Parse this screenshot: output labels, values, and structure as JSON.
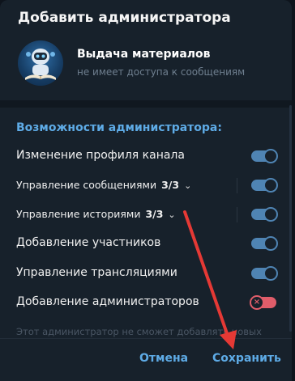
{
  "dialog": {
    "title": "Добавить администратора"
  },
  "profile": {
    "name": "Выдача материалов",
    "status": "не имеет доступа к сообщениям"
  },
  "permissions": {
    "title": "Возможности администратора:",
    "items": [
      {
        "label": "Изменение профиля канала",
        "count": "",
        "expandable": false,
        "enabled": true
      },
      {
        "label": "Управление сообщениями",
        "count": "3/3",
        "expandable": true,
        "enabled": true
      },
      {
        "label": "Управление историями",
        "count": "3/3",
        "expandable": true,
        "enabled": true
      },
      {
        "label": "Добавление участников",
        "count": "",
        "expandable": false,
        "enabled": true
      },
      {
        "label": "Управление трансляциями",
        "count": "",
        "expandable": false,
        "enabled": true
      },
      {
        "label": "Добавление администраторов",
        "count": "",
        "expandable": false,
        "enabled": false
      }
    ],
    "note": "Этот администратор не сможет добавлять новых"
  },
  "footer": {
    "cancel_label": "Отмена",
    "save_label": "Сохранить"
  },
  "colors": {
    "accent": "#5eabe6",
    "toggle_on": "#4f84b3",
    "toggle_off": "#e05d6a",
    "annotation_arrow": "#e53935"
  },
  "icons": {
    "chevron": "chevron-down-icon",
    "toggle_off_mark": "close-icon"
  }
}
